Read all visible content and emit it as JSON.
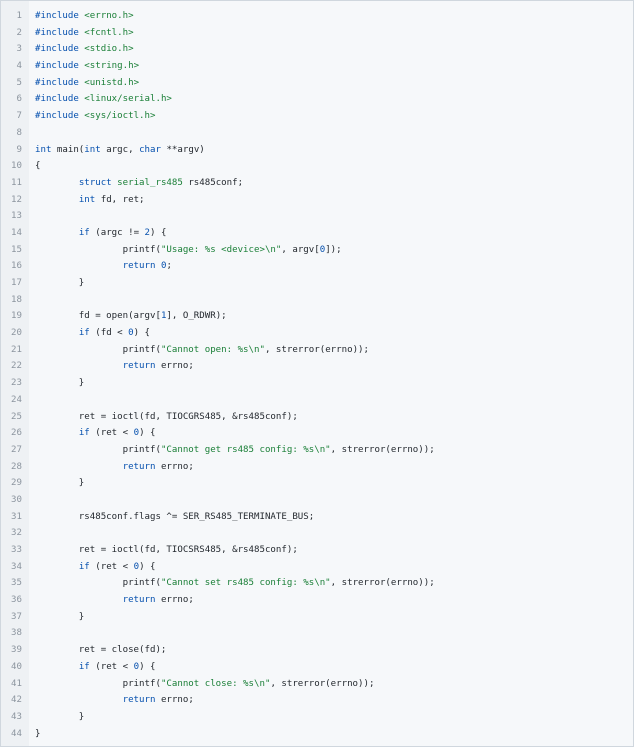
{
  "code_view": {
    "lines": [
      [
        {
          "t": "#include",
          "c": "pp"
        },
        {
          "t": " "
        },
        {
          "t": "<errno.h>",
          "c": "str"
        }
      ],
      [
        {
          "t": "#include",
          "c": "pp"
        },
        {
          "t": " "
        },
        {
          "t": "<fcntl.h>",
          "c": "str"
        }
      ],
      [
        {
          "t": "#include",
          "c": "pp"
        },
        {
          "t": " "
        },
        {
          "t": "<stdio.h>",
          "c": "str"
        }
      ],
      [
        {
          "t": "#include",
          "c": "pp"
        },
        {
          "t": " "
        },
        {
          "t": "<string.h>",
          "c": "str"
        }
      ],
      [
        {
          "t": "#include",
          "c": "pp"
        },
        {
          "t": " "
        },
        {
          "t": "<unistd.h>",
          "c": "str"
        }
      ],
      [
        {
          "t": "#include",
          "c": "pp"
        },
        {
          "t": " "
        },
        {
          "t": "<linux/serial.h>",
          "c": "str"
        }
      ],
      [
        {
          "t": "#include",
          "c": "pp"
        },
        {
          "t": " "
        },
        {
          "t": "<sys/ioctl.h>",
          "c": "str"
        }
      ],
      [],
      [
        {
          "t": "int",
          "c": "kw"
        },
        {
          "t": " main("
        },
        {
          "t": "int",
          "c": "kw"
        },
        {
          "t": " argc, "
        },
        {
          "t": "char",
          "c": "kw"
        },
        {
          "t": " **argv)"
        }
      ],
      [
        {
          "t": "{"
        }
      ],
      [
        {
          "t": "        "
        },
        {
          "t": "struct",
          "c": "kw"
        },
        {
          "t": " "
        },
        {
          "t": "serial_rs485",
          "c": "str"
        },
        {
          "t": " rs485conf;"
        }
      ],
      [
        {
          "t": "        "
        },
        {
          "t": "int",
          "c": "kw"
        },
        {
          "t": " fd, ret;"
        }
      ],
      [],
      [
        {
          "t": "        "
        },
        {
          "t": "if",
          "c": "kw"
        },
        {
          "t": " (argc != "
        },
        {
          "t": "2",
          "c": "num"
        },
        {
          "t": ") {"
        }
      ],
      [
        {
          "t": "                printf("
        },
        {
          "t": "\"Usage: %s <device>\\n\"",
          "c": "str"
        },
        {
          "t": ", argv["
        },
        {
          "t": "0",
          "c": "num"
        },
        {
          "t": "]);"
        }
      ],
      [
        {
          "t": "                "
        },
        {
          "t": "return",
          "c": "kw"
        },
        {
          "t": " "
        },
        {
          "t": "0",
          "c": "num"
        },
        {
          "t": ";"
        }
      ],
      [
        {
          "t": "        }"
        }
      ],
      [],
      [
        {
          "t": "        fd = open(argv["
        },
        {
          "t": "1",
          "c": "num"
        },
        {
          "t": "], O_RDWR);"
        }
      ],
      [
        {
          "t": "        "
        },
        {
          "t": "if",
          "c": "kw"
        },
        {
          "t": " (fd < "
        },
        {
          "t": "0",
          "c": "num"
        },
        {
          "t": ") {"
        }
      ],
      [
        {
          "t": "                printf("
        },
        {
          "t": "\"Cannot open: %s\\n\"",
          "c": "str"
        },
        {
          "t": ", strerror(errno));"
        }
      ],
      [
        {
          "t": "                "
        },
        {
          "t": "return",
          "c": "kw"
        },
        {
          "t": " errno;"
        }
      ],
      [
        {
          "t": "        }"
        }
      ],
      [],
      [
        {
          "t": "        ret = ioctl(fd, TIOCGRS485, &rs485conf);"
        }
      ],
      [
        {
          "t": "        "
        },
        {
          "t": "if",
          "c": "kw"
        },
        {
          "t": " (ret < "
        },
        {
          "t": "0",
          "c": "num"
        },
        {
          "t": ") {"
        }
      ],
      [
        {
          "t": "                printf("
        },
        {
          "t": "\"Cannot get rs485 config: %s\\n\"",
          "c": "str"
        },
        {
          "t": ", strerror(errno));"
        }
      ],
      [
        {
          "t": "                "
        },
        {
          "t": "return",
          "c": "kw"
        },
        {
          "t": " errno;"
        }
      ],
      [
        {
          "t": "        }"
        }
      ],
      [],
      [
        {
          "t": "        rs485conf.flags ^= SER_RS485_TERMINATE_BUS;"
        }
      ],
      [],
      [
        {
          "t": "        ret = ioctl(fd, TIOCSRS485, &rs485conf);"
        }
      ],
      [
        {
          "t": "        "
        },
        {
          "t": "if",
          "c": "kw"
        },
        {
          "t": " (ret < "
        },
        {
          "t": "0",
          "c": "num"
        },
        {
          "t": ") {"
        }
      ],
      [
        {
          "t": "                printf("
        },
        {
          "t": "\"Cannot set rs485 config: %s\\n\"",
          "c": "str"
        },
        {
          "t": ", strerror(errno));"
        }
      ],
      [
        {
          "t": "                "
        },
        {
          "t": "return",
          "c": "kw"
        },
        {
          "t": " errno;"
        }
      ],
      [
        {
          "t": "        }"
        }
      ],
      [],
      [
        {
          "t": "        ret = close(fd);"
        }
      ],
      [
        {
          "t": "        "
        },
        {
          "t": "if",
          "c": "kw"
        },
        {
          "t": " (ret < "
        },
        {
          "t": "0",
          "c": "num"
        },
        {
          "t": ") {"
        }
      ],
      [
        {
          "t": "                printf("
        },
        {
          "t": "\"Cannot close: %s\\n\"",
          "c": "str"
        },
        {
          "t": ", strerror(errno));"
        }
      ],
      [
        {
          "t": "                "
        },
        {
          "t": "return",
          "c": "kw"
        },
        {
          "t": " errno;"
        }
      ],
      [
        {
          "t": "        }"
        }
      ],
      [
        {
          "t": "}"
        }
      ]
    ]
  }
}
